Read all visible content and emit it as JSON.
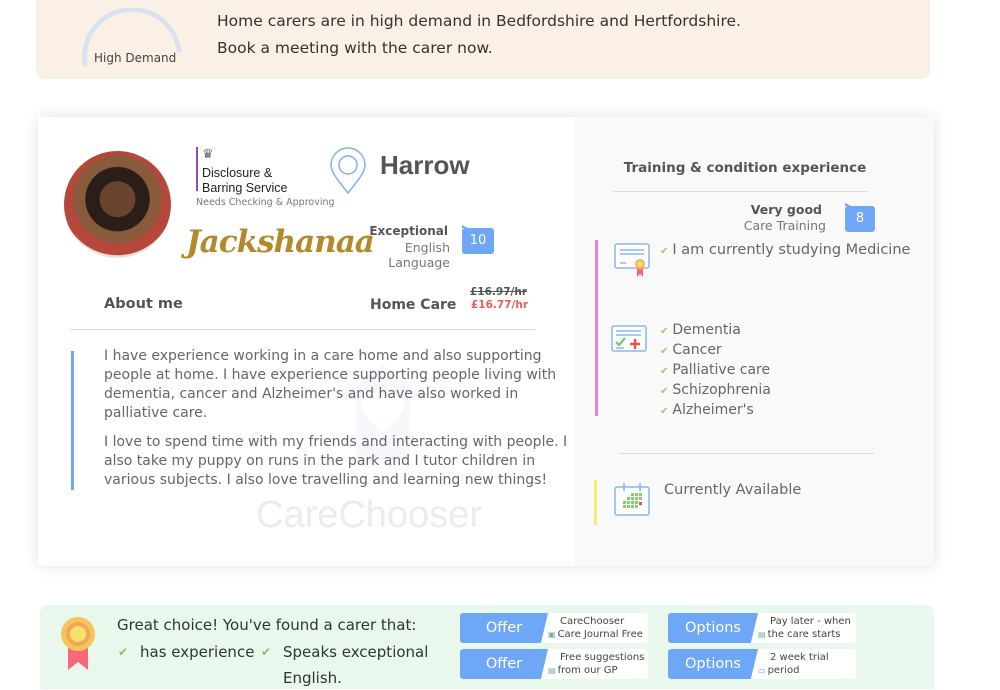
{
  "banner": {
    "gauge_label": "High Demand",
    "line1": "Home carers are in high demand in Bedfordshire and Hertfordshire.",
    "line2": "Book a meeting with the carer now."
  },
  "profile": {
    "name": "Jackshanaa",
    "location": "Harrow",
    "dbs": {
      "crest": "♛",
      "line1": "Disclosure &",
      "line2": "Barring Service",
      "status": "Needs Checking & Approving"
    },
    "english": {
      "rating": "Exceptional",
      "label": "English Language",
      "score": "10"
    }
  },
  "about": {
    "title": "About me",
    "service": "Home Care",
    "price_old": "£16.97/hr",
    "price_new": "£16.77/hr",
    "paragraphs": [
      "I have experience working in a care home and also supporting people at home. I have experience supporting people living with dementia, cancer and Alzheimer's and have also worked in palliative care.",
      "I love to spend time with my friends and interacting with people. I also take my puppy on runs in the park and I tutor children in various subjects. I also love travelling and learning new things!"
    ],
    "watermark": "CareChooser"
  },
  "training": {
    "title": "Training & condition experience",
    "rating": "Very good",
    "label": "Care Training",
    "score": "8",
    "studying": "I am currently studying Medicine",
    "conditions": [
      "Dementia",
      "Cancer",
      "Palliative care",
      "Schizophrenia",
      "Alzheimer's"
    ],
    "availability": "Currently Available",
    "tick": "✔"
  },
  "bottom": {
    "headline": "Great choice! You've found a carer that:",
    "features": [
      "has experience",
      "Speaks exceptional",
      "English."
    ],
    "tick": "✔",
    "pills": [
      {
        "tag": "Offer",
        "line1": "CareChooser",
        "line2": "Care Journal Free",
        "icon": "▣"
      },
      {
        "tag": "Offer",
        "line1": "Free suggestions",
        "line2": "from our GP",
        "icon": "▤"
      },
      {
        "tag": "Options",
        "line1": "Pay later - when",
        "line2": "the care starts",
        "icon": "▤"
      },
      {
        "tag": "Options",
        "line1": "2 week trial",
        "line2": "period",
        "icon": "▭"
      }
    ]
  },
  "colors": {
    "accent": "#6fa7f7",
    "price_discount": "#e95a5a",
    "name_gold": "#b38a2b",
    "banner_bg": "#faf0e6",
    "bottom_bg": "#e8f8ec"
  }
}
